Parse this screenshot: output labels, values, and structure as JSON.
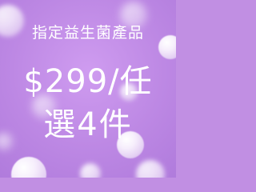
{
  "banner": {
    "subtitle": "指定益生菌產品",
    "price": "$299/任",
    "offer": "選4件"
  },
  "colors": {
    "background": "#c18fe3",
    "text": "#ffffff"
  }
}
